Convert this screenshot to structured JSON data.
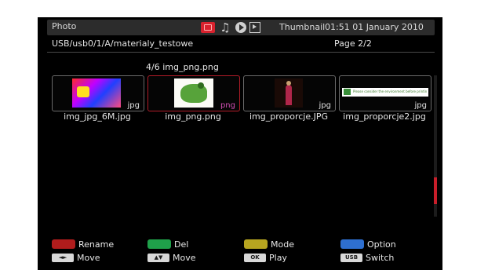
{
  "header": {
    "title": "Photo",
    "mode_icons": [
      "photo-icon",
      "music-icon",
      "video-icon",
      "movie-icon"
    ],
    "view_mode": "Thumbnail",
    "clock": "01:51 01 January 2010"
  },
  "location": {
    "path": "USB/usb0/1/A/materialy_testowe",
    "page": "Page 2/2"
  },
  "selected_info": "4/6 img_png.png",
  "thumbnails": [
    {
      "ext": "jpg",
      "filename": "img_jpg_6M.jpg"
    },
    {
      "ext": "png",
      "filename": "img_png.png",
      "selected": true
    },
    {
      "ext": "jpg",
      "filename": "img_proporcje.JPG"
    },
    {
      "ext": "jpg",
      "filename": "img_proporcje2.jpg",
      "doc_text": "Please consider the environment before printing this email"
    }
  ],
  "footer": {
    "row1": [
      {
        "key": "red",
        "label": "Rename"
      },
      {
        "key": "green",
        "label": "Del"
      },
      {
        "key": "yellow",
        "label": "Mode"
      },
      {
        "key": "blue",
        "label": "Option"
      }
    ],
    "row2": [
      {
        "key_label": "◄►",
        "label": "Move"
      },
      {
        "key_label": "▲▼",
        "label": "Move"
      },
      {
        "key_label": "OK",
        "label": "Play"
      },
      {
        "key_label": "USB",
        "label": "Switch"
      }
    ]
  },
  "colors": {
    "accent_red": "#c81e2a",
    "header_bg": "#2c2c2c",
    "png_ext": "#d04fb3",
    "key_red": "#b01c1c",
    "key_green": "#1fa04a",
    "key_yellow": "#b7a520",
    "key_blue": "#2e6fd0"
  }
}
